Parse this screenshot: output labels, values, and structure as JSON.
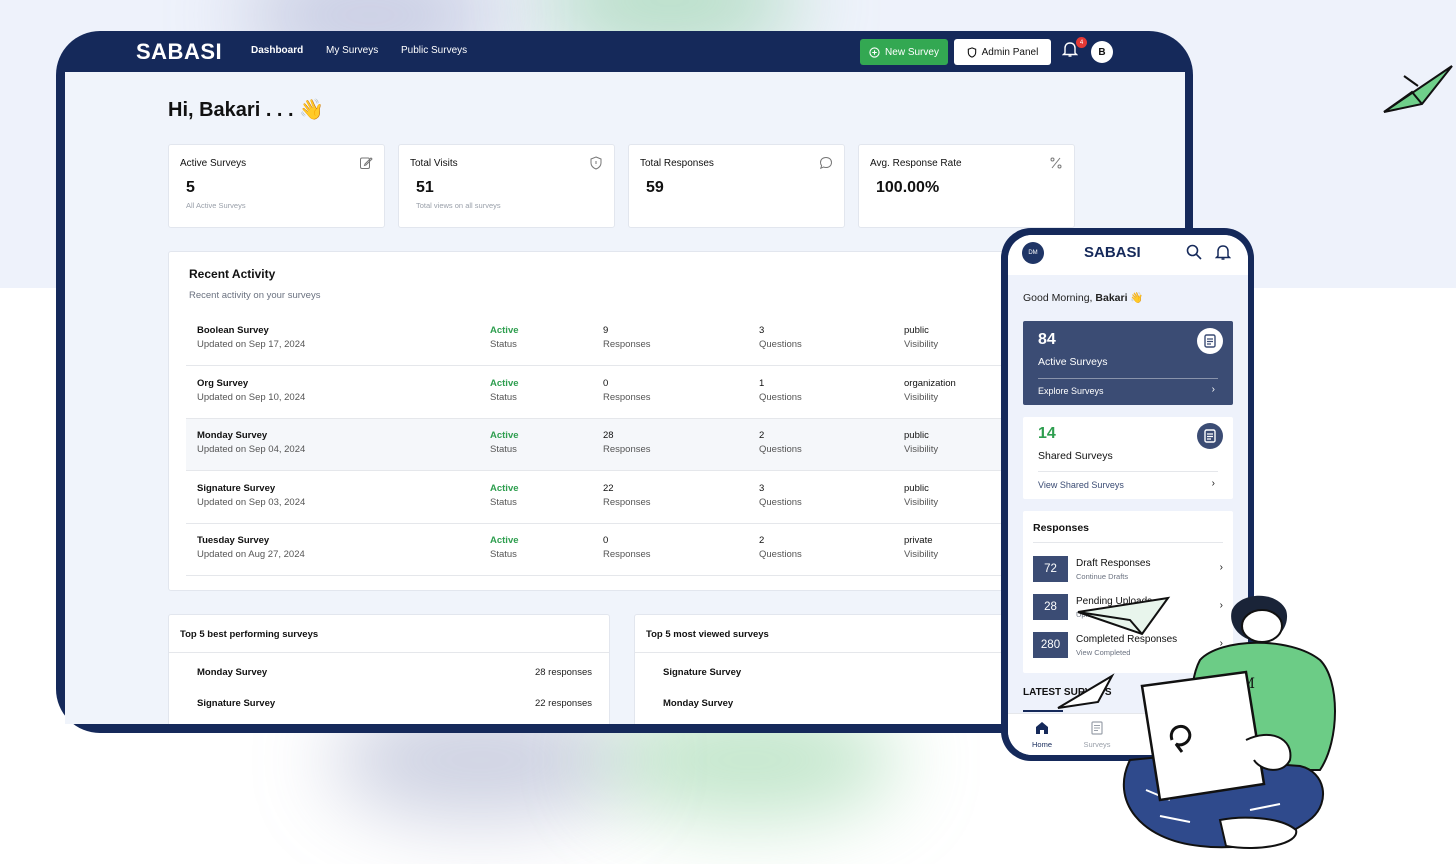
{
  "app": {
    "logo": "SABASI",
    "nav": [
      "Dashboard",
      "My Surveys",
      "Public Surveys"
    ],
    "new_survey_label": "New Survey",
    "admin_panel_label": "Admin Panel",
    "notification_count": "4",
    "avatar_initial": "B"
  },
  "dashboard": {
    "greeting": "Hi, Bakari . . . 👋",
    "stats": [
      {
        "label": "Active Surveys",
        "value": "5",
        "sub": "All Active Surveys",
        "icon": "edit-icon"
      },
      {
        "label": "Total Visits",
        "value": "51",
        "sub": "Total views on all surveys",
        "icon": "shield-icon"
      },
      {
        "label": "Total Responses",
        "value": "59",
        "sub": "",
        "icon": "chat-icon"
      },
      {
        "label": "Avg. Response Rate",
        "value": "100.00%",
        "sub": "",
        "icon": "percent-icon"
      }
    ],
    "activity": {
      "title": "Recent Activity",
      "subtitle": "Recent activity on your surveys",
      "rows": [
        {
          "name": "Boolean Survey",
          "updated": "Updated on Sep 17, 2024",
          "status": "Active",
          "status_label": "Status",
          "responses": "9",
          "responses_label": "Responses",
          "questions": "3",
          "questions_label": "Questions",
          "visibility": "public",
          "visibility_label": "Visibility"
        },
        {
          "name": "Org Survey",
          "updated": "Updated on Sep 10, 2024",
          "status": "Active",
          "status_label": "Status",
          "responses": "0",
          "responses_label": "Responses",
          "questions": "1",
          "questions_label": "Questions",
          "visibility": "organization",
          "visibility_label": "Visibility"
        },
        {
          "name": "Monday Survey",
          "updated": "Updated on Sep 04, 2024",
          "status": "Active",
          "status_label": "Status",
          "responses": "28",
          "responses_label": "Responses",
          "questions": "2",
          "questions_label": "Questions",
          "visibility": "public",
          "visibility_label": "Visibility"
        },
        {
          "name": "Signature Survey",
          "updated": "Updated on Sep 03, 2024",
          "status": "Active",
          "status_label": "Status",
          "responses": "22",
          "responses_label": "Responses",
          "questions": "3",
          "questions_label": "Questions",
          "visibility": "public",
          "visibility_label": "Visibility"
        },
        {
          "name": "Tuesday Survey",
          "updated": "Updated on Aug 27, 2024",
          "status": "Active",
          "status_label": "Status",
          "responses": "0",
          "responses_label": "Responses",
          "questions": "2",
          "questions_label": "Questions",
          "visibility": "private",
          "visibility_label": "Visibility"
        }
      ]
    },
    "top_performing": {
      "title": "Top 5 best performing surveys",
      "items": [
        {
          "name": "Monday Survey",
          "count": "28 responses"
        },
        {
          "name": "Signature Survey",
          "count": "22 responses"
        }
      ]
    },
    "top_viewed": {
      "title": "Top 5 most viewed surveys",
      "items": [
        {
          "name": "Signature Survey"
        },
        {
          "name": "Monday Survey"
        }
      ]
    }
  },
  "mobile": {
    "avatar": "DM",
    "logo": "SABASI",
    "greeting_prefix": "Good Morning,",
    "greeting_name": "Bakari",
    "greeting_emoji": "👋",
    "active_card": {
      "value": "84",
      "label": "Active Surveys",
      "link": "Explore Surveys"
    },
    "shared_card": {
      "value": "14",
      "label": "Shared Surveys",
      "link": "View Shared Surveys"
    },
    "responses": {
      "title": "Responses",
      "items": [
        {
          "value": "72",
          "label": "Draft Responses",
          "sub": "Continue Drafts"
        },
        {
          "value": "28",
          "label": "Pending Uploads",
          "sub": "Upload"
        },
        {
          "value": "280",
          "label": "Completed Responses",
          "sub": "View Completed"
        }
      ]
    },
    "latest_label": "LATEST SURVEYS",
    "tabs": [
      "Home",
      "Surveys"
    ]
  },
  "colors": {
    "navy": "#15295a",
    "card_navy": "#3b4c74",
    "accent_green": "#33a852",
    "status_green": "#2e9e4f"
  }
}
